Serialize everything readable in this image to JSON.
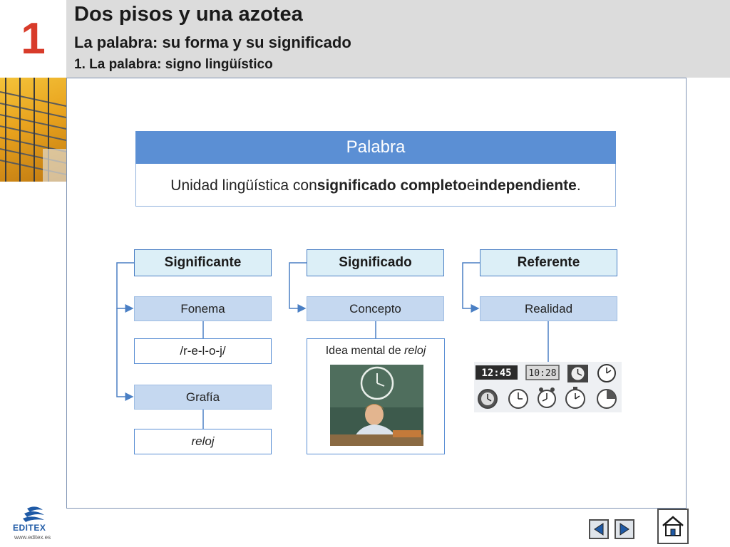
{
  "header": {
    "unit_number": "1",
    "title": "Dos pisos y una azotea",
    "subtitle": "La palabra: su forma y su significado",
    "section": "1. La palabra: signo lingüístico"
  },
  "word_box": {
    "heading": "Palabra",
    "definition_pre": "Unidad lingüística con ",
    "definition_bold1": "significado completo",
    "definition_mid": " e ",
    "definition_bold2": "independiente",
    "definition_end": "."
  },
  "columns": {
    "significante": {
      "label": "Significante",
      "sub1": "Fonema",
      "val1": "/r-e-l-o-j/",
      "sub2": "Grafía",
      "val2": "reloj"
    },
    "significado": {
      "label": "Significado",
      "sub1": "Concepto",
      "idea_pre": "Idea mental de ",
      "idea_word": "reloj"
    },
    "referente": {
      "label": "Referente",
      "sub1": "Realidad"
    }
  },
  "clock_panel": {
    "digital1": "12:45",
    "digital2": "10:28"
  },
  "logo": {
    "name": "EDITEX",
    "url": "www.editex.es"
  },
  "icons": {
    "prev": "prev-arrow-icon",
    "next": "next-arrow-icon",
    "home": "home-icon"
  },
  "colors": {
    "unit_number": "#d83b2a",
    "header_bg": "#dcdcdc",
    "word_heading_bg": "#5b8fd4",
    "category_bg": "#dceff7",
    "subnode_bg": "#c5d8f0",
    "connector": "#4a7fc4"
  }
}
